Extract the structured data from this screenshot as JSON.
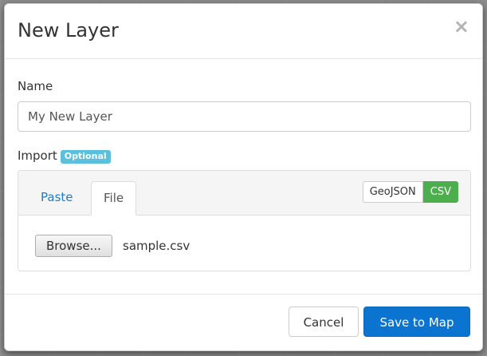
{
  "modal": {
    "title": "New Layer",
    "close_symbol": "×",
    "close_icon": "close-icon"
  },
  "name_field": {
    "label": "Name",
    "value": "My New Layer"
  },
  "import": {
    "label": "Import",
    "badge": "Optional",
    "badge_color": "#5bc0de",
    "tabs": [
      {
        "label": "Paste",
        "active": false
      },
      {
        "label": "File",
        "active": true
      }
    ],
    "formats": [
      {
        "label": "GeoJSON",
        "active": false
      },
      {
        "label": "CSV",
        "active": true,
        "color": "#4cae4c"
      }
    ],
    "browse_label": "Browse...",
    "file_name": "sample.csv"
  },
  "footer": {
    "cancel_label": "Cancel",
    "save_label": "Save to Map",
    "save_color": "#0b74d1"
  }
}
